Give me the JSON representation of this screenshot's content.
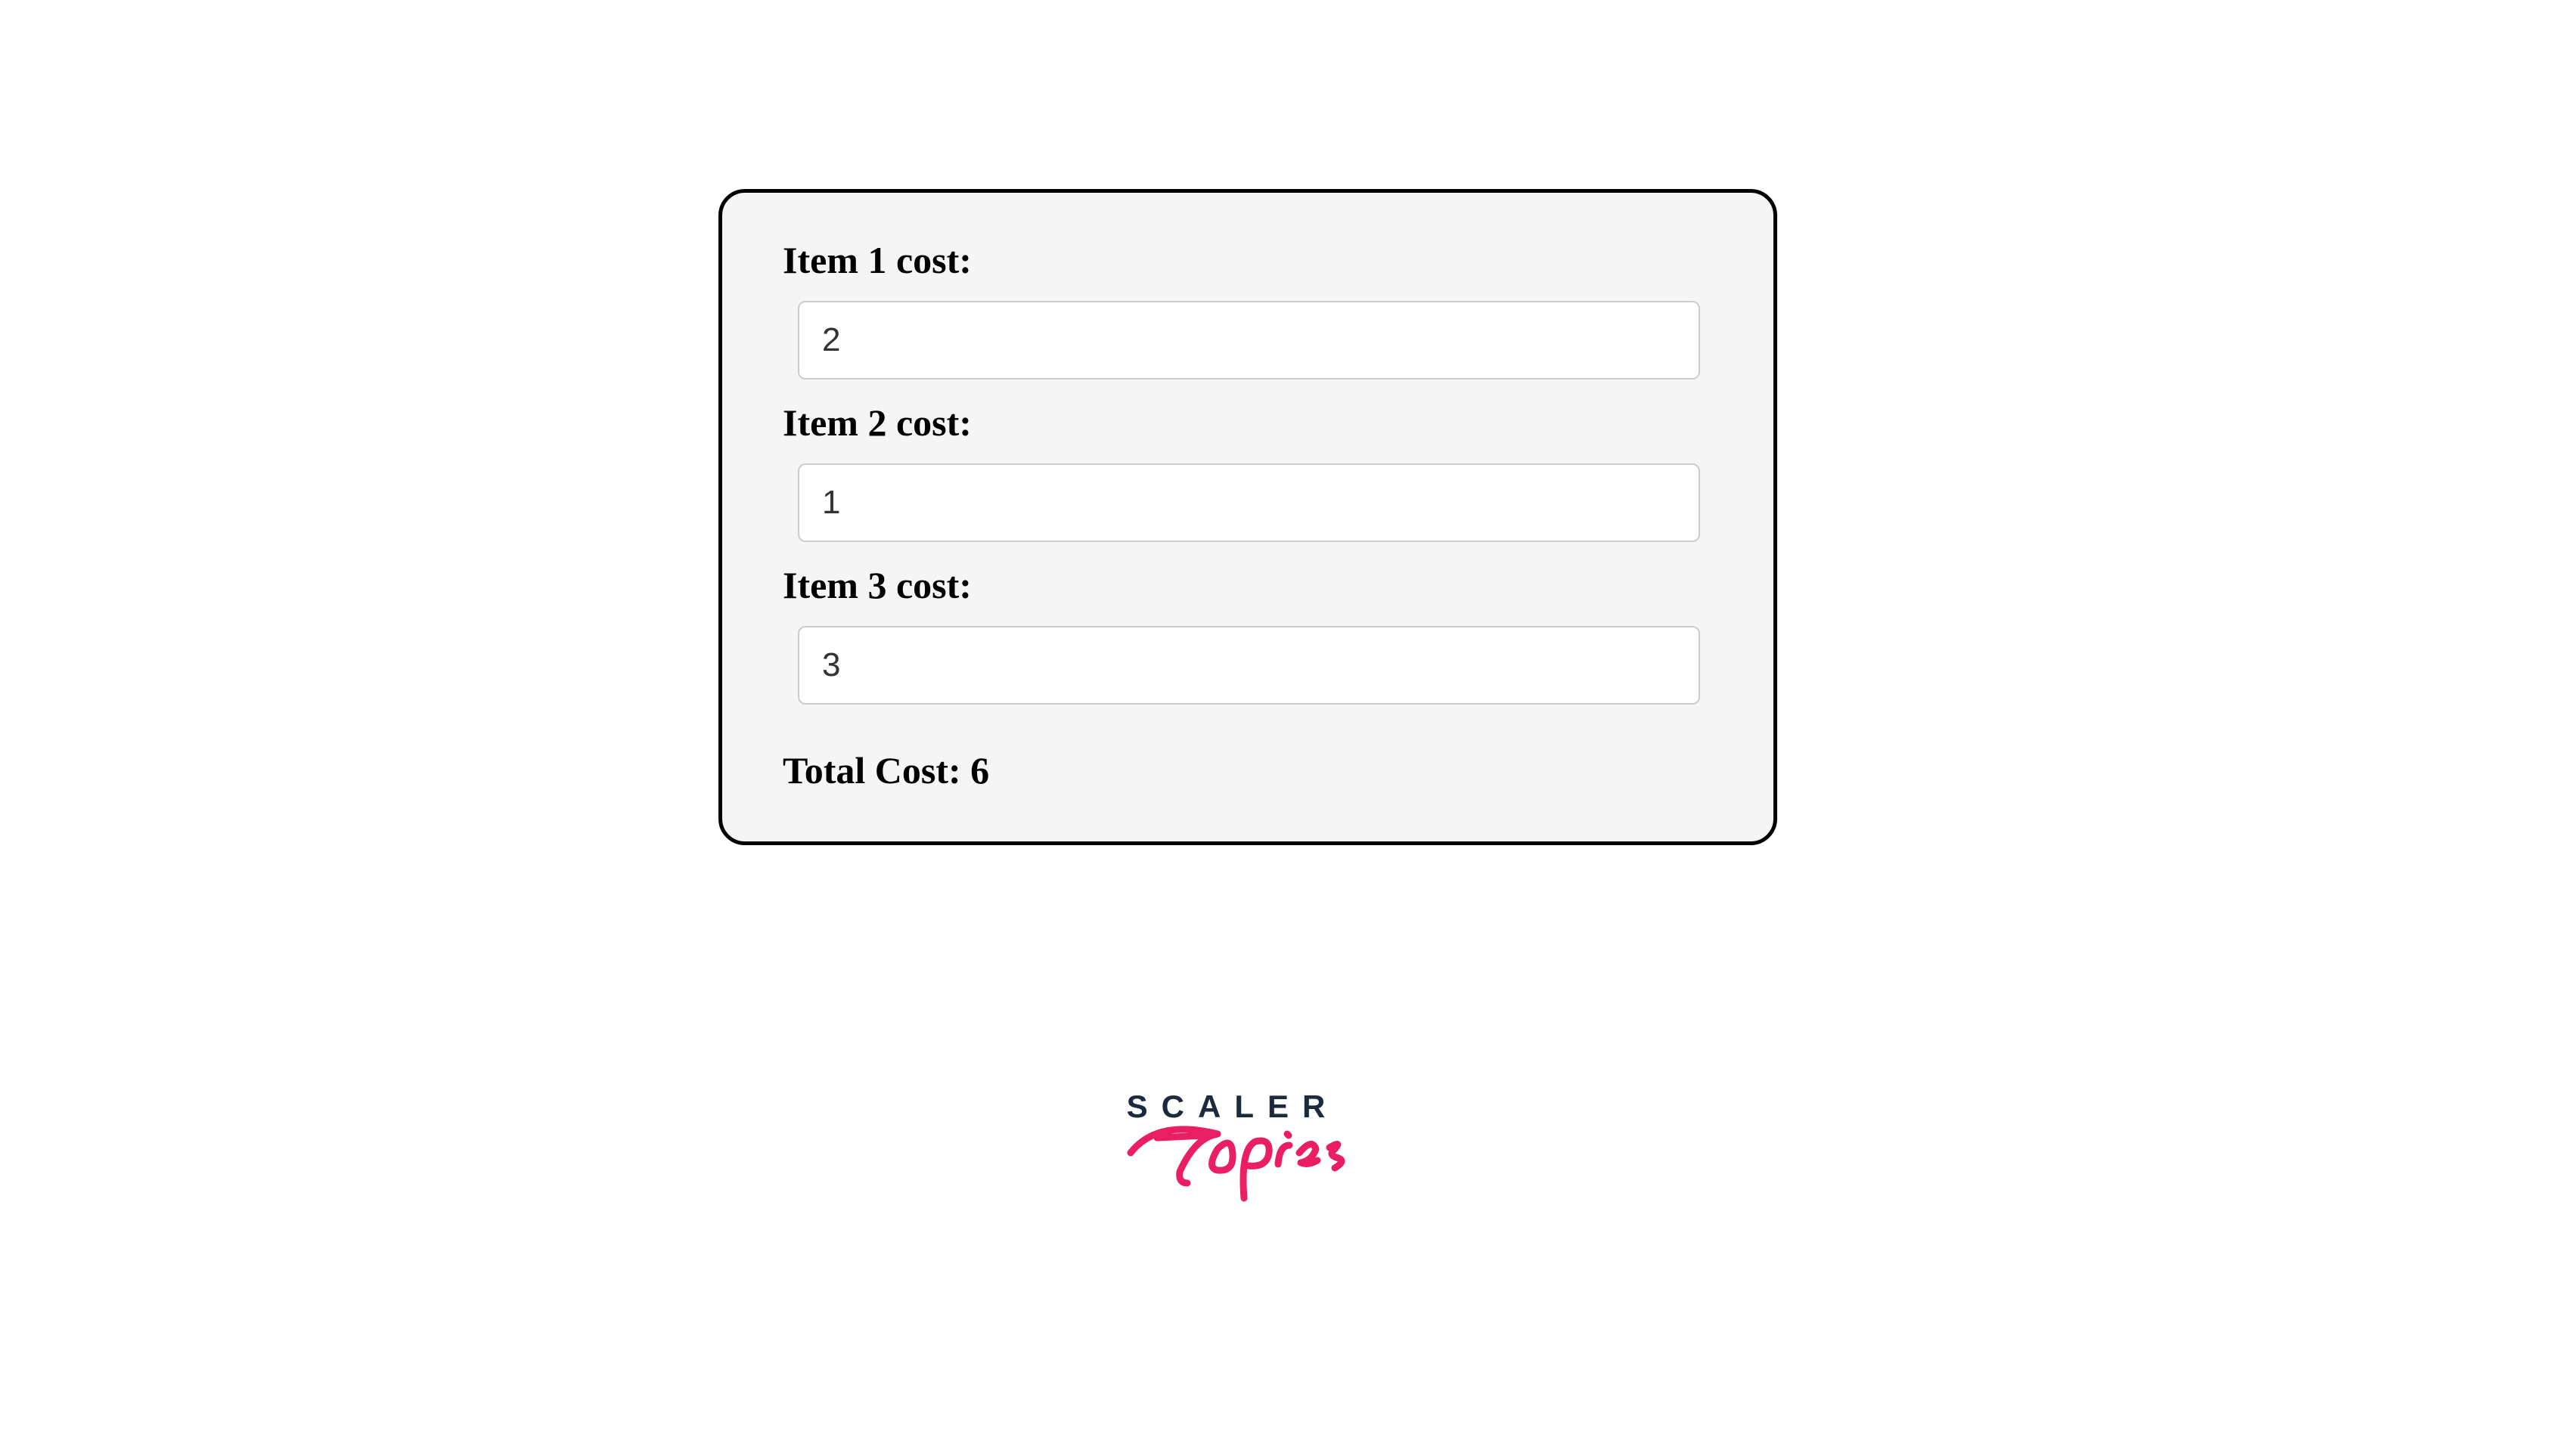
{
  "form": {
    "fields": [
      {
        "label": "Item 1 cost:",
        "value": "2"
      },
      {
        "label": "Item 2 cost:",
        "value": "1"
      },
      {
        "label": "Item 3 cost:",
        "value": "3"
      }
    ],
    "total_label": "Total Cost: ",
    "total_value": "6"
  },
  "branding": {
    "line1": "SCALER",
    "line2": "Topics",
    "color_dark": "#1b2a3d",
    "color_accent": "#e91e63"
  }
}
